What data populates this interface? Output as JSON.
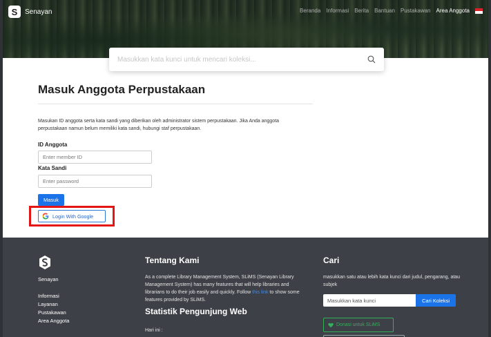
{
  "header": {
    "brand": "Senayan",
    "logo_letter": "S",
    "nav": [
      "Beranda",
      "Informasi",
      "Berita",
      "Bantuan",
      "Pustakawan",
      "Area Anggota"
    ]
  },
  "search": {
    "placeholder": "Masukkan kata kunci untuk mencari koleksi..."
  },
  "login": {
    "title": "Masuk Anggota Perpustakaan",
    "description": "Masukan ID anggota serta kata sandi yang diberikan oleh administrator sistem perpustakaan. Jika Anda anggota perpustakaan namun belum memiliki kata sandi, hubungi staf perpustakaan.",
    "id_label": "ID Anggota",
    "id_placeholder": "Enter member ID",
    "password_label": "Kata Sandi",
    "password_placeholder": "Enter password",
    "submit_label": "Masuk",
    "google_label": "Login With Google"
  },
  "footer": {
    "brand": "Senayan",
    "links": [
      "Informasi",
      "Layanan",
      "Pustakawan",
      "Area Anggota"
    ],
    "about_title": "Tentang Kami",
    "about_text_1": "As a complete Library Management System, SLiMS (Senayan Library Management System) has many features that will help libraries and librarians to do their job easily and quickly. Follow",
    "about_link": "this link",
    "about_text_2": "to show some features provided by SLiMS.",
    "stats_title": "Statistik Pengunjung Web",
    "stats_today": "Hari ini :",
    "search_title": "Cari",
    "search_text": "masukkan satu atau lebih kata kunci dari judul, pengarang, atau subjek",
    "search_placeholder": "Masukkan kata kunci",
    "search_button": "Cari Koleksi",
    "donate_label": "Donasi untuk SLiMS"
  },
  "colors": {
    "primary": "#1a73e8",
    "highlight_box": "#e51414",
    "footer_bg": "#3d4046",
    "donate": "#33b05a"
  }
}
